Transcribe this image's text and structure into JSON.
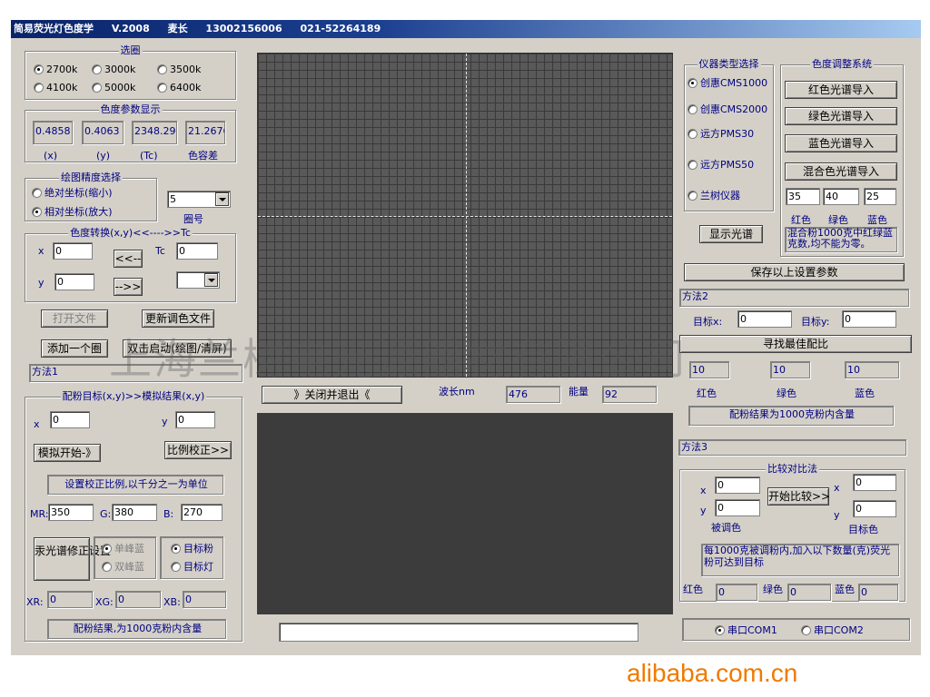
{
  "title": {
    "app": "简易荧光灯色度学",
    "version": "V.2008",
    "role": "麦长",
    "phone1": "13002156006",
    "phone2": "021-52264189"
  },
  "circle_select": {
    "legend": "选圈",
    "options": [
      "2700k",
      "3000k",
      "3500k",
      "4100k",
      "5000k",
      "6400k"
    ],
    "selected": "2700k"
  },
  "chroma_display": {
    "legend": "色度参数显示",
    "values": [
      "0.4858",
      "0.4063",
      "2348.298",
      "21.2676"
    ],
    "labels": [
      "(x)",
      "(y)",
      "(Tc)",
      "色容差"
    ]
  },
  "precision": {
    "legend": "绘图精度选择",
    "abs": "绝对坐标(缩小)",
    "rel": "相对坐标(放大)",
    "selected": "rel",
    "circle_no": "5",
    "circle_label": "圈号"
  },
  "convert": {
    "legend": "色度转换(x,y)<<---->>Tc",
    "x_label": "x",
    "y_label": "y",
    "x_value": "0",
    "y_value": "0",
    "tc_label": "Tc",
    "tc_value": "0",
    "btn_left": "<<--",
    "btn_right": "-->>"
  },
  "buttons": {
    "open_file": "打开文件",
    "update_file": "更新调色文件",
    "add_circle": "添加一个圈",
    "dblclick": "双击启动(绘图/清屏)",
    "close_exit": "》关闭并退出《"
  },
  "method1": "方法1",
  "match": {
    "legend": "配粉目标(x,y)>>模拟结果(x,y)",
    "x_label": "x",
    "y_label": "y",
    "x_value": "0",
    "y_value": "0",
    "start": "模拟开始-》",
    "ratio": "比例校正>>",
    "ratio_note": "设置校正比例,以千分之一为单位",
    "mr_label": "MR:",
    "mr": "350",
    "g_label": "G:",
    "g": "380",
    "b_label": "B:",
    "b": "270",
    "spectrum_fix": "汞光谱修正设置",
    "single": "单峰蓝",
    "double": "双峰蓝",
    "target_powder": "目标粉",
    "target_lamp": "目标灯",
    "xr_label": "XR:",
    "xr": "0",
    "xg_label": "XG:",
    "xg": "0",
    "xb_label": "XB:",
    "xb": "0",
    "result": "配粉结果,为1000克粉内含量"
  },
  "wave": {
    "label": "波长nm",
    "value": "476",
    "energy_label": "能量",
    "energy": "92"
  },
  "instrument": {
    "legend": "仪器类型选择",
    "options": [
      "创惠CMS1000",
      "创惠CMS2000",
      "远方PMS30",
      "远方PMS50",
      "兰树仪器"
    ],
    "selected": "创惠CMS1000",
    "show": "显示光谱"
  },
  "color_adjust": {
    "legend": "色度调整系统",
    "red": "红色光谱导入",
    "green": "绿色光谱导入",
    "blue": "蓝色光谱导入",
    "mixed": "混合色光谱导入",
    "r": "35",
    "g": "40",
    "b": "25",
    "r_label": "红色",
    "g_label": "绿色",
    "b_label": "蓝色",
    "note": "混合粉1000克中红绿蓝克数,均不能为零。"
  },
  "save": "保存以上设置参数",
  "method2": {
    "title": "方法2",
    "tx_label": "目标x:",
    "tx": "0",
    "ty_label": "目标y:",
    "ty": "0",
    "find": "寻找最佳配比",
    "vals": [
      "10",
      "10",
      "10"
    ],
    "labels": [
      "红色",
      "绿色",
      "蓝色"
    ],
    "result": "配粉结果为1000克粉内含量"
  },
  "method3": {
    "title": "方法3",
    "legend": "比较对比法",
    "x_label": "x",
    "y_label": "y",
    "x1": "0",
    "y1": "0",
    "x2": "0",
    "y2": "0",
    "compare": "开始比较>>",
    "adjusted": "被调色",
    "target": "目标色",
    "note": "每1000克被调粉内,加入以下数量(克)荧光粉可达到目标",
    "r_label": "红色",
    "r": "0",
    "g_label": "绿色",
    "g": "0",
    "b_label": "蓝色",
    "b": "0"
  },
  "serial": {
    "com1": "串口COM1",
    "com2": "串口COM2",
    "selected": "com1"
  },
  "watermark": "上海兰树电光源器材有限公司",
  "footer": "alibaba.com.cn"
}
